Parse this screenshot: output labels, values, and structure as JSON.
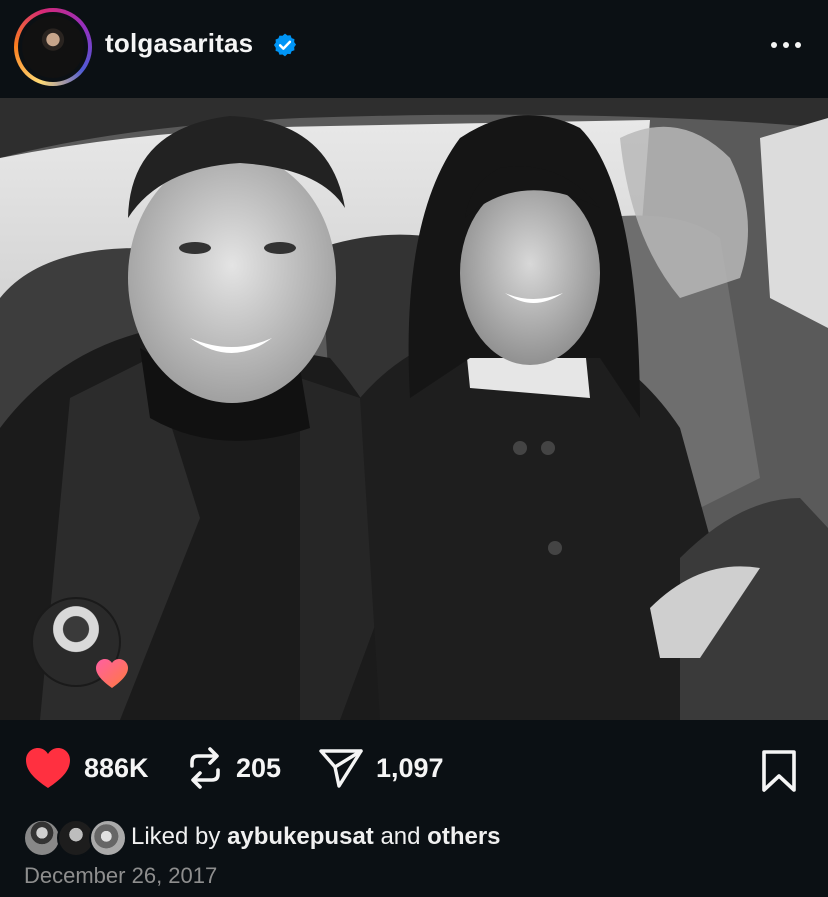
{
  "header": {
    "username": "tolgasaritas",
    "verified_icon": "verified-badge-icon",
    "more_icon": "more-options-icon"
  },
  "post": {
    "photo_description_icon": "photo",
    "tagged_icon": "heart-icon"
  },
  "actions": {
    "likes": "886K",
    "reposts": "205",
    "shares": "1,097",
    "like_icon": "heart-filled-icon",
    "repost_icon": "repost-icon",
    "share_icon": "send-icon",
    "save_icon": "bookmark-icon"
  },
  "liked_by": {
    "prefix": "Liked by",
    "user": "aybukepusat",
    "connector": "and",
    "others": "others"
  },
  "date": "December 26, 2017",
  "colors": {
    "background": "#0b1014",
    "like_red": "#ff3040",
    "verified_blue": "#0095f6",
    "muted_text": "#8e8e8e"
  }
}
